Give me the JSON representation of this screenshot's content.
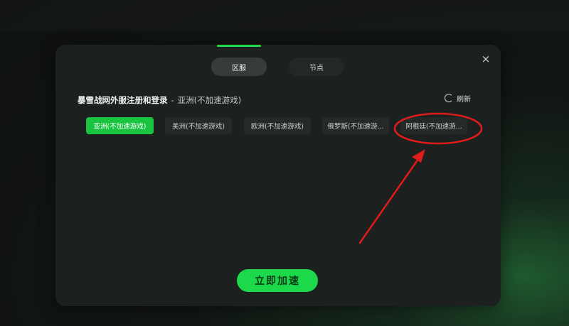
{
  "tabs": [
    {
      "label": "区服",
      "active": true
    },
    {
      "label": "节点",
      "active": false
    }
  ],
  "close_icon": "×",
  "heading": {
    "game": "暴雪战网外服注册和登录",
    "separator": "-",
    "region": "亚洲(不加速游戏)"
  },
  "refresh_label": "刷新",
  "regions": [
    {
      "label": "亚洲(不加速游戏)",
      "selected": true
    },
    {
      "label": "美洲(不加速游戏)",
      "selected": false
    },
    {
      "label": "欧洲(不加速游戏)",
      "selected": false
    },
    {
      "label": "俄罗斯(不加速游...",
      "selected": false
    },
    {
      "label": "阿根廷(不加速游...",
      "selected": false
    }
  ],
  "accelerate_label": "立即加速",
  "colors": {
    "accent": "#1bd94a",
    "annotation": "#e01b1b"
  }
}
